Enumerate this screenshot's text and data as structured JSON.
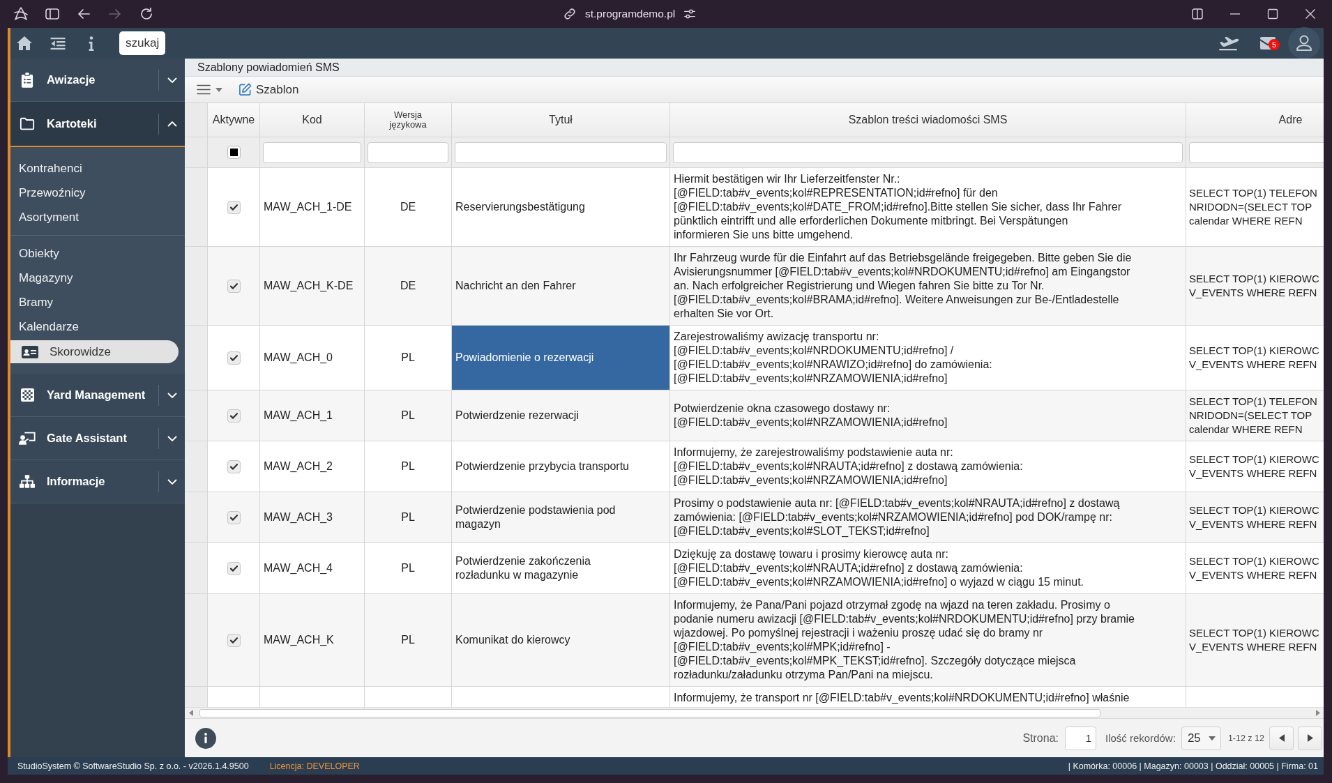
{
  "browser": {
    "url": "st.programdemo.pl",
    "forward_disabled": true
  },
  "header": {
    "search_button": "szukaj",
    "mail_count": "5"
  },
  "sidebar": {
    "sections": [
      {
        "label": "Awizacje",
        "expanded": false
      },
      {
        "label": "Kartoteki",
        "expanded": true,
        "groups": [
          {
            "items": [
              {
                "label": "Kontrahenci",
                "selected": false
              },
              {
                "label": "Przewoźnicy",
                "selected": false
              },
              {
                "label": "Asortyment",
                "selected": false
              }
            ]
          },
          {
            "items": [
              {
                "label": "Obiekty",
                "selected": false
              },
              {
                "label": "Magazyny",
                "selected": false
              },
              {
                "label": "Bramy",
                "selected": false
              },
              {
                "label": "Kalendarze",
                "selected": false
              },
              {
                "label": "Skorowidze",
                "selected": true
              }
            ]
          }
        ]
      },
      {
        "label": "Yard Management",
        "expanded": false
      },
      {
        "label": "Gate Assistant",
        "expanded": false
      },
      {
        "label": "Informacje",
        "expanded": false
      }
    ]
  },
  "page": {
    "title": "Szablony powiadomień SMS"
  },
  "toolbar": {
    "edit_button": "Szablon"
  },
  "grid": {
    "columns": [
      {
        "label": "Aktywne",
        "kind": "checkbox",
        "filter_indeterminate": true
      },
      {
        "label": "Kod",
        "kind": "text"
      },
      {
        "label": "Wersja\njęzykowa",
        "kind": "short",
        "compact": true
      },
      {
        "label": "Tytuł",
        "kind": "text"
      },
      {
        "label": "Szablon treści wiadomości SMS",
        "kind": "text"
      },
      {
        "label": "Adre",
        "kind": "text"
      }
    ],
    "rows": [
      {
        "cells": [
          {
            "checked": true,
            "selected": false
          },
          {
            "text": "MAW_ACH_1-DE",
            "selected": false
          },
          {
            "text": "DE",
            "selected": false
          },
          {
            "text": "Reservierungsbestätigung",
            "selected": false
          },
          {
            "text": "Hiermit bestätigen wir Ihr Lieferzeitfenster Nr.:\n[@FIELD:tab#v_events;kol#REPRESENTATION;id#refno] für den\n[@FIELD:tab#v_events;kol#DATE_FROM;id#refno].Bitte stellen Sie sicher, dass Ihr Fahrer\npünktlich eintrifft und alle erforderlichen Dokumente mitbringt. Bei Verspätungen\ninformieren Sie uns bitte umgehend.",
            "selected": false
          },
          {
            "text": "SELECT TOP(1) TELEFON\nNRIDODN=(SELECT TOP\ncalendar WHERE REFN",
            "selected": false
          }
        ]
      },
      {
        "cells": [
          {
            "checked": true,
            "selected": false
          },
          {
            "text": "MAW_ACH_K-DE",
            "selected": false
          },
          {
            "text": "DE",
            "selected": false
          },
          {
            "text": "Nachricht an den Fahrer",
            "selected": false
          },
          {
            "text": "Ihr Fahrzeug wurde für die Einfahrt auf das Betriebsgelände freigegeben. Bitte geben Sie die\nAvisierungsnummer [@FIELD:tab#v_events;kol#NRDOKUMENTU;id#refno] am Eingangstor\nan. Nach erfolgreicher Registrierung und Wiegen fahren Sie bitte zu Tor Nr.\n[@FIELD:tab#v_events;kol#BRAMA;id#refno]. Weitere Anweisungen zur Be-/Entladestelle\nerhalten Sie vor Ort.",
            "selected": false
          },
          {
            "text": "SELECT TOP(1) KIEROWC\nV_EVENTS WHERE REFN",
            "selected": false
          }
        ]
      },
      {
        "cells": [
          {
            "checked": true,
            "selected": false
          },
          {
            "text": "MAW_ACH_0",
            "selected": false
          },
          {
            "text": "PL",
            "selected": false
          },
          {
            "text": "Powiadomienie o rezerwacji",
            "selected": true
          },
          {
            "text": "Zarejestrowaliśmy awizację transportu nr:\n[@FIELD:tab#v_events;kol#NRDOKUMENTU;id#refno] /\n[@FIELD:tab#v_events;kol#NRAWIZO;id#refno] do zamówienia:\n[@FIELD:tab#v_events;kol#NRZAMOWIENIA;id#refno]",
            "selected": false
          },
          {
            "text": "SELECT TOP(1) KIEROWC\nV_EVENTS WHERE REFN",
            "selected": false
          }
        ]
      },
      {
        "cells": [
          {
            "checked": true,
            "selected": false
          },
          {
            "text": "MAW_ACH_1",
            "selected": false
          },
          {
            "text": "PL",
            "selected": false
          },
          {
            "text": "Potwierdzenie rezerwacji",
            "selected": false
          },
          {
            "text": "Potwierdzenie okna czasowego dostawy nr:\n[@FIELD:tab#v_events;kol#NRZAMOWIENIA;id#refno]",
            "selected": false
          },
          {
            "text": "SELECT TOP(1) TELEFON\nNRIDODN=(SELECT TOP\ncalendar WHERE REFN",
            "selected": false
          }
        ]
      },
      {
        "cells": [
          {
            "checked": true,
            "selected": false
          },
          {
            "text": "MAW_ACH_2",
            "selected": false
          },
          {
            "text": "PL",
            "selected": false
          },
          {
            "text": "Potwierdzenie przybycia transportu",
            "selected": false
          },
          {
            "text": "Informujemy, że zarejestrowaliśmy podstawienie auta nr:\n[@FIELD:tab#v_events;kol#NRAUTA;id#refno] z dostawą zamówienia:\n[@FIELD:tab#v_events;kol#NRZAMOWIENIA;id#refno]",
            "selected": false
          },
          {
            "text": "SELECT TOP(1) KIEROWC\nV_EVENTS WHERE REFN",
            "selected": false
          }
        ]
      },
      {
        "cells": [
          {
            "checked": true,
            "selected": false
          },
          {
            "text": "MAW_ACH_3",
            "selected": false
          },
          {
            "text": "PL",
            "selected": false
          },
          {
            "text": "Potwierdzenie podstawienia pod\nmagazyn",
            "selected": false
          },
          {
            "text": "Prosimy o podstawienie auta nr: [@FIELD:tab#v_events;kol#NRAUTA;id#refno] z dostawą\nzamówienia: [@FIELD:tab#v_events;kol#NRZAMOWIENIA;id#refno] pod DOK/rampę nr:\n[@FIELD:tab#v_events;kol#SLOT_TEKST;id#refno]",
            "selected": false
          },
          {
            "text": "SELECT TOP(1) KIEROWC\nV_EVENTS WHERE REFN",
            "selected": false
          }
        ]
      },
      {
        "cells": [
          {
            "checked": true,
            "selected": false
          },
          {
            "text": "MAW_ACH_4",
            "selected": false
          },
          {
            "text": "PL",
            "selected": false
          },
          {
            "text": "Potwierdzenie zakończenia\nrozładunku w magazynie",
            "selected": false
          },
          {
            "text": "Dziękuję za dostawę towaru i prosimy kierowcę auta nr:\n[@FIELD:tab#v_events;kol#NRAUTA;id#refno] z dostawą zamówienia:\n[@FIELD:tab#v_events;kol#NRZAMOWIENIA;id#refno] o wyjazd w ciągu 15 minut.",
            "selected": false
          },
          {
            "text": "SELECT TOP(1) KIEROWC\nV_EVENTS WHERE REFN",
            "selected": false
          }
        ]
      },
      {
        "cells": [
          {
            "checked": true,
            "selected": false
          },
          {
            "text": "MAW_ACH_K",
            "selected": false
          },
          {
            "text": "PL",
            "selected": false
          },
          {
            "text": "Komunikat do kierowcy",
            "selected": false
          },
          {
            "text": "Informujemy, że Pana/Pani pojazd otrzymał zgodę na wjazd na teren zakładu. Prosimy o\npodanie numeru awizacji [@FIELD:tab#v_events;kol#NRDOKUMENTU;id#refno] przy bramie\nwjazdowej. Po pomyślnej rejestracji i ważeniu proszę udać się do bramy nr\n[@FIELD:tab#v_events;kol#MPK;id#refno] -\n[@FIELD:tab#v_events;kol#MPK_TEKST;id#refno]. Szczegóły dotyczące miejsca\nrozładunku/załadunku otrzyma Pan/Pani na miejscu.",
            "selected": false
          },
          {
            "text": "SELECT TOP(1) KIEROWC\nV_EVENTS WHERE REFN",
            "selected": false
          }
        ]
      },
      {
        "cells": [
          "",
          "",
          "",
          "",
          {
            "text": "Informujemy, że transport nr [@FIELD:tab#v_events;kol#NRDOKUMENTU;id#refno] właśnie",
            "selected": false
          },
          ""
        ]
      }
    ]
  },
  "pager": {
    "page_label": "Strona:",
    "page": "1",
    "size_label": "Ilość rekordów:",
    "page_size": "25",
    "range": "1-12 z 12"
  },
  "status_bar": {
    "copyright": "StudioSystem © SoftwareStudio Sp. z o.o. - v2026.1.4.9500",
    "license": "Licencja: DEVELOPER",
    "info": "| Komórka: 00006 | Magazyn: 00003 | Oddział: 00005 | Firma: 01"
  }
}
